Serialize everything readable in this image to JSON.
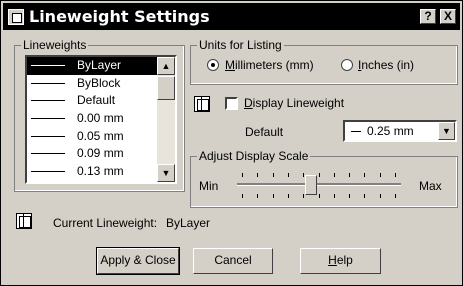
{
  "window": {
    "title": "Lineweight Settings",
    "help_button": "?",
    "close_button": "X"
  },
  "lineweights": {
    "legend": "Lineweights",
    "items": [
      "ByLayer",
      "ByBlock",
      "Default",
      "0.00 mm",
      "0.05 mm",
      "0.09 mm",
      "0.13 mm"
    ],
    "selected": "ByLayer"
  },
  "units": {
    "legend": "Units for Listing",
    "millimeters_label": "Millimeters (mm)",
    "inches_label": "Inches (in)",
    "selected": "Millimeters (mm)"
  },
  "display": {
    "checkbox_label": "Display Lineweight",
    "checked": false,
    "default_label": "Default",
    "default_value": "0.25 mm"
  },
  "scale": {
    "legend": "Adjust Display Scale",
    "min_label": "Min",
    "max_label": "Max",
    "position_fraction": 0.45
  },
  "current": {
    "label": "Current Lineweight:",
    "value": "ByLayer"
  },
  "buttons": {
    "apply_close": "Apply & Close",
    "cancel": "Cancel",
    "help": "Help"
  },
  "icons": {
    "title": "window-app-icon",
    "display": "lineweight-icon",
    "current": "lineweight-icon"
  }
}
